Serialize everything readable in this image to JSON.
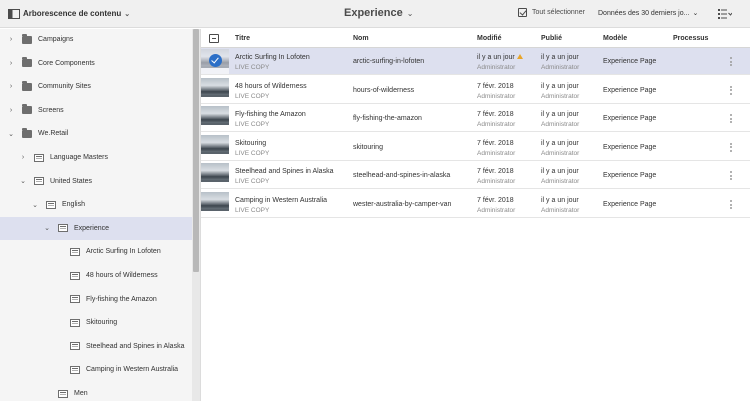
{
  "header": {
    "rail_title": "Arborescence de contenu",
    "center_title": "Experience",
    "select_all": "Tout sélectionner",
    "date_filter": "Données des 30 derniers jo..."
  },
  "tree": [
    {
      "label": "Campaigns",
      "type": "folder",
      "toggle": "›",
      "name": "campaigns"
    },
    {
      "label": "Core Components",
      "type": "folder",
      "toggle": "›",
      "name": "core-components"
    },
    {
      "label": "Community Sites",
      "type": "folder",
      "toggle": "›",
      "name": "community-sites"
    },
    {
      "label": "Screens",
      "type": "folder",
      "toggle": "›",
      "name": "screens"
    },
    {
      "label": "We.Retail",
      "type": "folder",
      "toggle": "⌄",
      "name": "we-retail"
    },
    {
      "label": "Language Masters",
      "type": "page",
      "toggle": "›",
      "name": "language-masters"
    },
    {
      "label": "United States",
      "type": "page",
      "toggle": "⌄",
      "name": "united-states"
    },
    {
      "label": "English",
      "type": "page",
      "toggle": "⌄",
      "name": "english"
    },
    {
      "label": "Experience",
      "type": "page",
      "toggle": "⌄",
      "name": "experience"
    },
    {
      "label": "Arctic Surfing In Lofoten",
      "type": "page",
      "toggle": "",
      "name": "arctic-surfing"
    },
    {
      "label": "48 hours of Wilderness",
      "type": "page",
      "toggle": "",
      "name": "48-hours"
    },
    {
      "label": "Fly-fishing the Amazon",
      "type": "page",
      "toggle": "",
      "name": "fly-fishing"
    },
    {
      "label": "Skitouring",
      "type": "page",
      "toggle": "",
      "name": "skitouring"
    },
    {
      "label": "Steelhead and Spines in Alaska",
      "type": "page",
      "toggle": "",
      "name": "steelhead"
    },
    {
      "label": "Camping in Western Australia",
      "type": "page",
      "toggle": "",
      "name": "camping"
    },
    {
      "label": "Men",
      "type": "page",
      "toggle": "",
      "name": "men"
    }
  ],
  "table": {
    "columns": [
      "Titre",
      "Nom",
      "Modifié",
      "Publié",
      "Modèle",
      "Processus"
    ],
    "rows": [
      {
        "title": "Arctic Surfing In Lofoten",
        "status": "LIVE COPY",
        "name": "arctic-surfing-in-lofoten",
        "modified": "il y a un jour",
        "modified_by": "Administrator",
        "published": "il y a un jour",
        "published_by": "Administrator",
        "template": "Experience Page",
        "warning": true
      },
      {
        "title": "48 hours of Wilderness",
        "status": "LIVE COPY",
        "name": "hours-of-wilderness",
        "modified": "7 févr. 2018",
        "modified_by": "Administrator",
        "published": "il y a un jour",
        "published_by": "Administrator",
        "template": "Experience Page",
        "warning": false
      },
      {
        "title": "Fly-fishing the Amazon",
        "status": "LIVE COPY",
        "name": "fly-fishing-the-amazon",
        "modified": "7 févr. 2018",
        "modified_by": "Administrator",
        "published": "il y a un jour",
        "published_by": "Administrator",
        "template": "Experience Page",
        "warning": false
      },
      {
        "title": "Skitouring",
        "status": "LIVE COPY",
        "name": "skitouring",
        "modified": "7 févr. 2018",
        "modified_by": "Administrator",
        "published": "il y a un jour",
        "published_by": "Administrator",
        "template": "Experience Page",
        "warning": false
      },
      {
        "title": "Steelhead and Spines in Alaska",
        "status": "LIVE COPY",
        "name": "steelhead-and-spines-in-alaska",
        "modified": "7 févr. 2018",
        "modified_by": "Administrator",
        "published": "il y a un jour",
        "published_by": "Administrator",
        "template": "Experience Page",
        "warning": false
      },
      {
        "title": "Camping in Western Australia",
        "status": "LIVE COPY",
        "name": "wester-australia-by-camper-van",
        "modified": "7 févr. 2018",
        "modified_by": "Administrator",
        "published": "il y a un jour",
        "published_by": "Administrator",
        "template": "Experience Page",
        "warning": false
      }
    ]
  },
  "colors": {
    "selection": "#dde0ef",
    "accent": "#2c6fc7",
    "warning": "#e8a52a"
  }
}
